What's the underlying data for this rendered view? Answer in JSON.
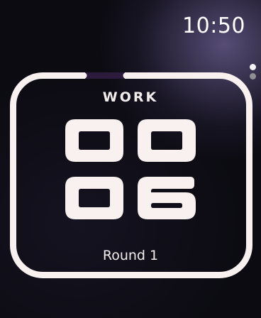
{
  "status_bar": {
    "time": "10:50"
  },
  "pager": {
    "page_count": 2,
    "current_page": 1
  },
  "timer": {
    "phase": "WORK",
    "minutes": "00",
    "seconds": "06",
    "round_label": "Round 1",
    "progress": 0.05
  },
  "colors": {
    "ring": "#f8f1f0",
    "ring_progress": "#2d1b3d",
    "text": "#f3ecec",
    "digits": "#f8f1f0"
  }
}
